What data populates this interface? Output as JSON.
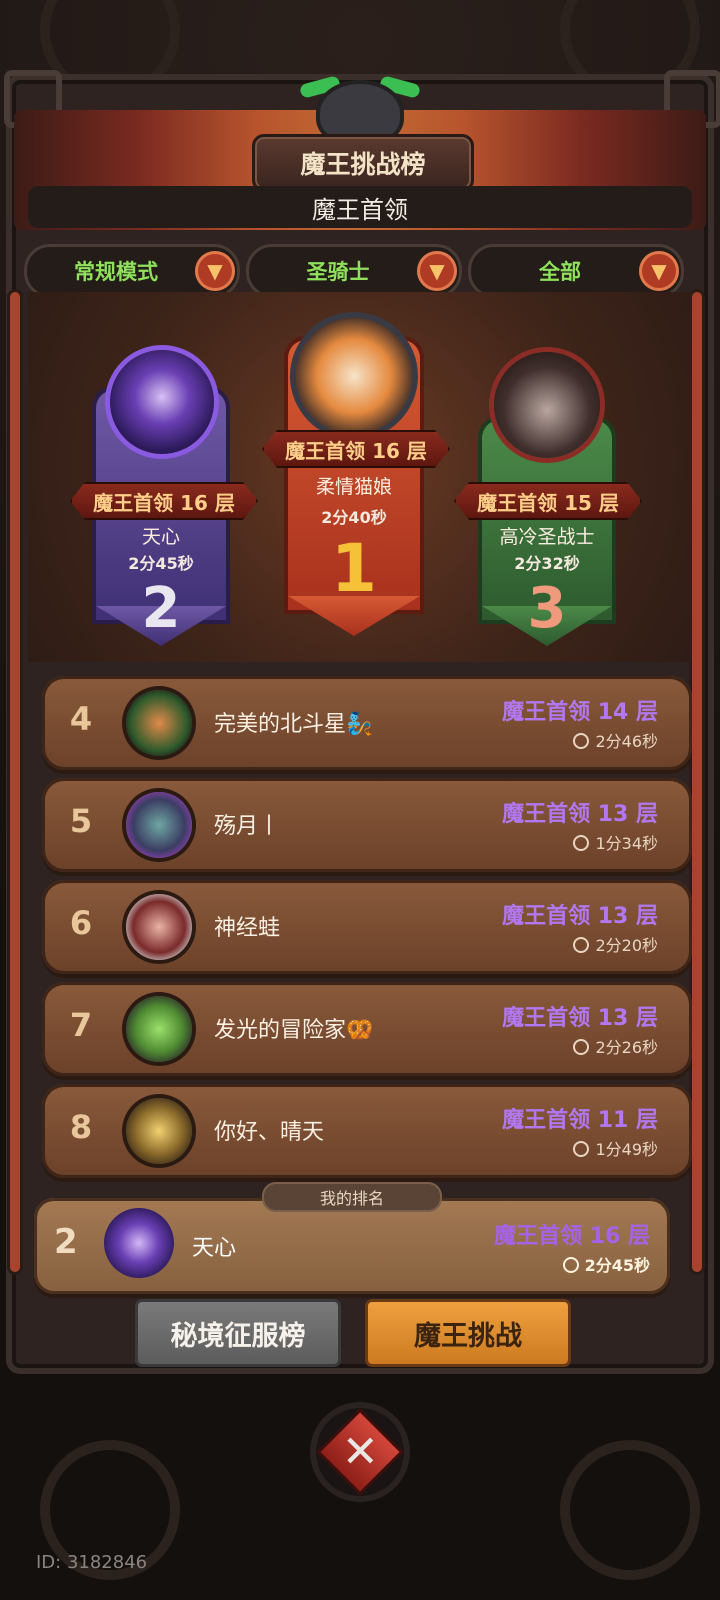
{
  "header": {
    "title": "魔王挑战榜",
    "subtitle": "魔王首领"
  },
  "filters": [
    {
      "label": "常规模式"
    },
    {
      "label": "圣骑士"
    },
    {
      "label": "全部"
    }
  ],
  "podium": {
    "first": {
      "rank": "1",
      "floor": "魔王首领 16 层",
      "name": "柔情猫娘",
      "time": "2分40秒"
    },
    "second": {
      "rank": "2",
      "floor": "魔王首领 16 层",
      "name": "天心",
      "time": "2分45秒"
    },
    "third": {
      "rank": "3",
      "floor": "魔王首领 15 层",
      "name": "高冷圣战士",
      "time": "2分32秒"
    }
  },
  "ranking": [
    {
      "rank": "4",
      "name": "完美的北斗星🧞",
      "floor": "魔王首领 14 层",
      "time": "2分46秒",
      "avatar_color": "#2f5a2b"
    },
    {
      "rank": "5",
      "name": "殇月丨",
      "floor": "魔王首领 13 层",
      "time": "1分34秒",
      "avatar_color": "#3b3e63"
    },
    {
      "rank": "6",
      "name": "神经蛙",
      "floor": "魔王首领 13 层",
      "time": "2分20秒",
      "avatar_color": "#7a2a2a"
    },
    {
      "rank": "7",
      "name": "发光的冒险家🥨",
      "floor": "魔王首领 13 层",
      "time": "2分26秒",
      "avatar_color": "#4f8a32"
    },
    {
      "rank": "8",
      "name": "你好、晴天",
      "floor": "魔王首领 11 层",
      "time": "1分49秒",
      "avatar_color": "#8a6a2a"
    }
  ],
  "my_rank": {
    "tag": "我的排名",
    "rank": "2",
    "name": "天心",
    "floor": "魔王首领 16 层",
    "time": "2分45秒"
  },
  "tabs": {
    "left": "秘境征服榜",
    "right": "魔王挑战"
  },
  "footer": {
    "id_text": "ID: 3182846"
  },
  "icons": {
    "dropdown": "caret-down-icon",
    "close": "close-icon",
    "clock": "clock-icon"
  }
}
